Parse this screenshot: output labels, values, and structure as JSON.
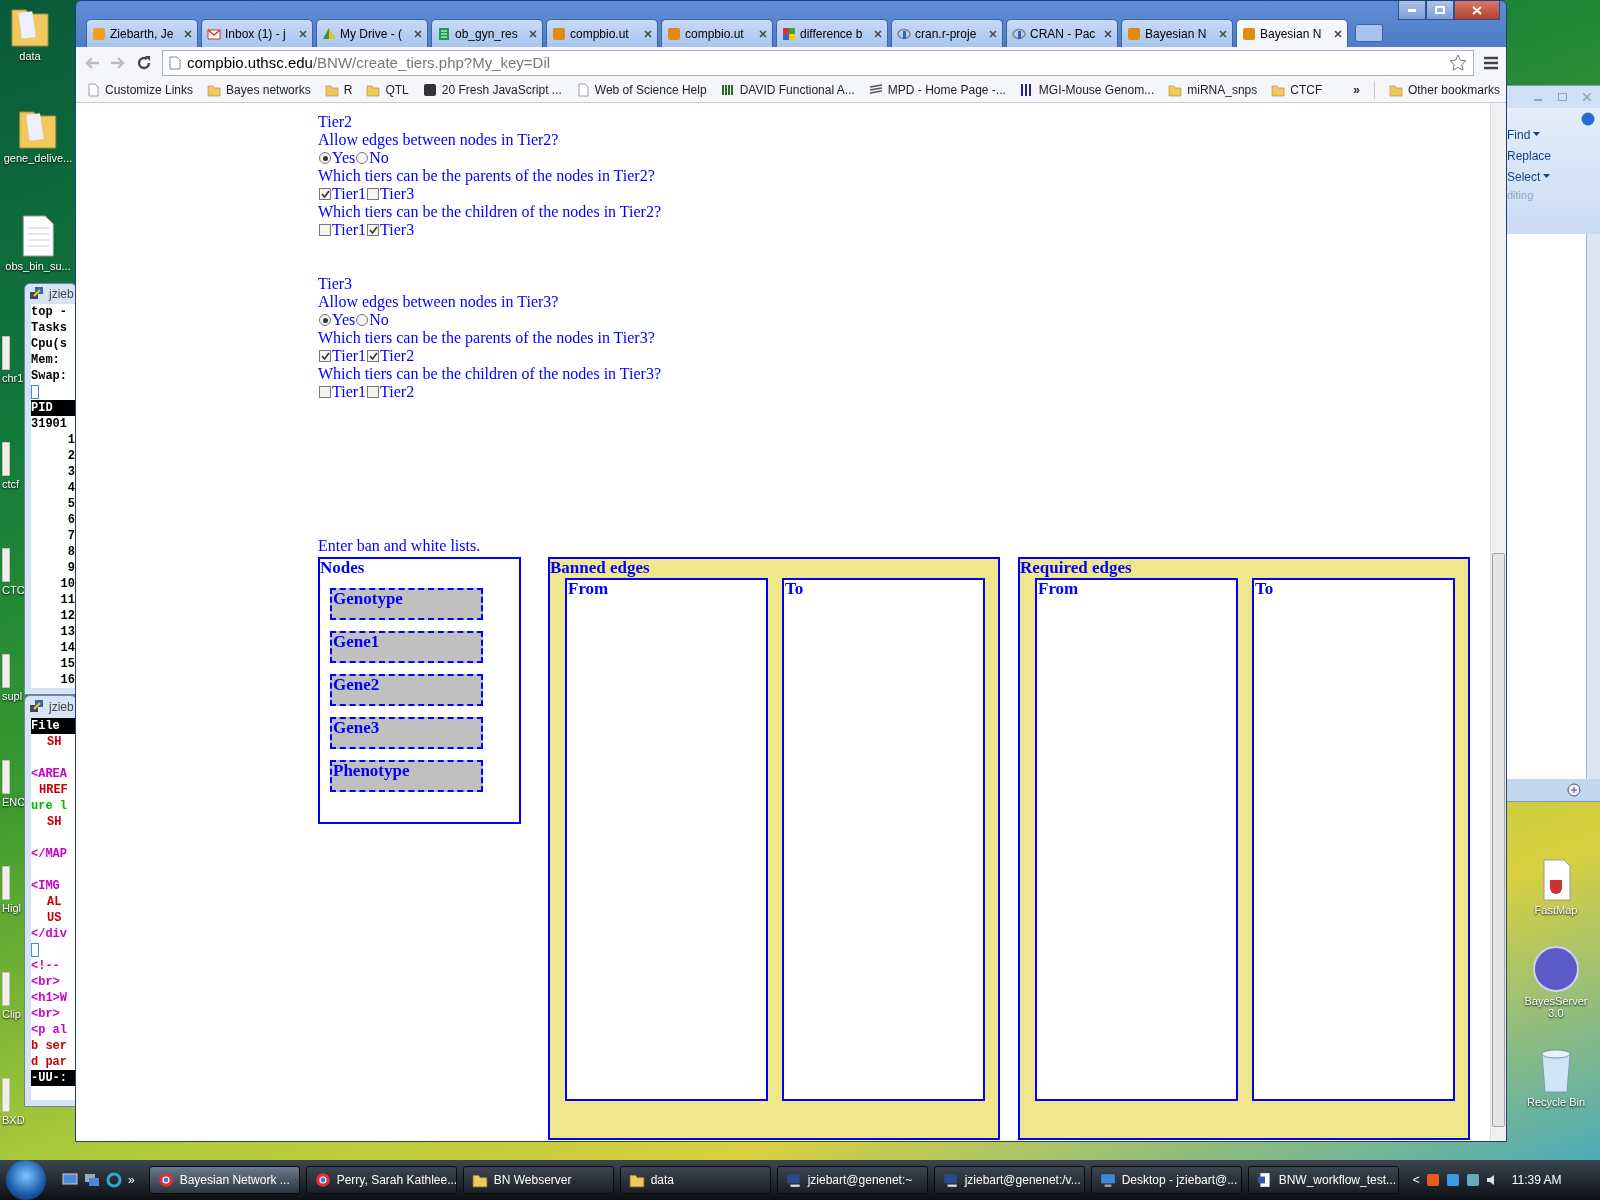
{
  "desktop_icons_left": [
    {
      "label": "data",
      "kind": "folder"
    },
    {
      "label": "gene_delive...",
      "kind": "folder"
    },
    {
      "label": "obs_bin_su...",
      "kind": "file"
    },
    {
      "label": "chr1",
      "kind": "partial"
    },
    {
      "label": "ctcf",
      "kind": "partial"
    },
    {
      "label": "CTC",
      "kind": "partial"
    },
    {
      "label": "supl",
      "kind": "partial"
    },
    {
      "label": "ENC",
      "kind": "partial"
    },
    {
      "label": "Higl",
      "kind": "partial"
    },
    {
      "label": "Clip",
      "kind": "partial"
    },
    {
      "label": "BXD",
      "kind": "partial"
    }
  ],
  "terminals": [
    {
      "title": "jzieb",
      "lines": [
        {
          "text": "top -",
          "kind": "text"
        },
        {
          "text": "Tasks",
          "kind": "text"
        },
        {
          "text": "Cpu(s",
          "kind": "text"
        },
        {
          "text": "Mem:",
          "kind": "text"
        },
        {
          "text": "Swap:",
          "kind": "text"
        },
        {
          "kind": "cursor"
        },
        {
          "text": "PID",
          "kind": "bar"
        },
        {
          "text": "31901",
          "kind": "text"
        },
        {
          "text": "1",
          "kind": "right"
        },
        {
          "text": "2",
          "kind": "right"
        },
        {
          "text": "3",
          "kind": "right"
        },
        {
          "text": "4",
          "kind": "right"
        },
        {
          "text": "5",
          "kind": "right"
        },
        {
          "text": "6",
          "kind": "right"
        },
        {
          "text": "7",
          "kind": "right"
        },
        {
          "text": "8",
          "kind": "right"
        },
        {
          "text": "9",
          "kind": "right"
        },
        {
          "text": "10",
          "kind": "right"
        },
        {
          "text": "11",
          "kind": "right"
        },
        {
          "text": "12",
          "kind": "right"
        },
        {
          "text": "13",
          "kind": "right"
        },
        {
          "text": "14",
          "kind": "right"
        },
        {
          "text": "15",
          "kind": "right"
        },
        {
          "text": "16",
          "kind": "right"
        }
      ]
    },
    {
      "title": "jzieb",
      "lines": [
        {
          "text": "File",
          "kind": "bar"
        },
        {
          "text": "SH",
          "kind": "indented",
          "color": "#cc0000"
        },
        {
          "kind": "blank"
        },
        {
          "text": "<AREA",
          "kind": "text",
          "color": "#cc00cc"
        },
        {
          "text": "HREF",
          "kind": "half",
          "color": "#cc0000"
        },
        {
          "text": "ure l",
          "kind": "text",
          "color": "#00bb00"
        },
        {
          "text": "SH",
          "kind": "indented",
          "color": "#cc0000"
        },
        {
          "kind": "blank"
        },
        {
          "text": "</MAP",
          "kind": "text",
          "color": "#cc00cc"
        },
        {
          "kind": "blank"
        },
        {
          "text": "<IMG",
          "kind": "text",
          "color": "#cc00cc"
        },
        {
          "text": "AL",
          "kind": "indented",
          "color": "#cc0000"
        },
        {
          "text": "US",
          "kind": "indented",
          "color": "#cc0000"
        },
        {
          "text": "</div",
          "kind": "text",
          "color": "#cc00cc"
        },
        {
          "kind": "cursor"
        },
        {
          "text": "<!--",
          "kind": "text",
          "color": "#cc00cc"
        },
        {
          "text": "<br>",
          "kind": "text",
          "color": "#cc00cc"
        },
        {
          "text": "<h1>W",
          "kind": "text",
          "color": "#cc00cc"
        },
        {
          "text": "<br>",
          "kind": "text",
          "color": "#cc00cc"
        },
        {
          "text": "<p al",
          "kind": "text",
          "color": "#cc00cc"
        },
        {
          "text": "b ser",
          "kind": "text",
          "color": "#cc0000"
        },
        {
          "text": "d par",
          "kind": "text",
          "color": "#cc0000"
        },
        {
          "text": "-UU-:",
          "kind": "bar"
        }
      ]
    }
  ],
  "word_window": {
    "ribbon_items": [
      {
        "label": "Find",
        "dropdown": true
      },
      {
        "label": "Replace",
        "dropdown": false
      },
      {
        "label": "Select",
        "dropdown": true
      }
    ],
    "group_label": "diting"
  },
  "desktop_icons_right": [
    {
      "label": "FastMap",
      "kind": "java"
    },
    {
      "label": "BayesServer 3.0",
      "kind": "orb"
    },
    {
      "label": "Recycle Bin",
      "kind": "bin"
    }
  ],
  "browser": {
    "tabs": [
      {
        "label": "Ziebarth, Je",
        "kind": "outlook",
        "selected": false
      },
      {
        "label": "Inbox (1) - j",
        "kind": "mail",
        "selected": false
      },
      {
        "label": "My Drive - (",
        "kind": "drive",
        "selected": false
      },
      {
        "label": "ob_gyn_res",
        "kind": "sheet",
        "selected": false
      },
      {
        "label": "compbio.ut",
        "kind": "ut",
        "selected": false
      },
      {
        "label": "compbio.ut",
        "kind": "ut",
        "selected": false
      },
      {
        "label": "difference b",
        "kind": "google",
        "selected": false
      },
      {
        "label": "cran.r-proje",
        "kind": "r",
        "selected": false
      },
      {
        "label": "CRAN - Pac",
        "kind": "r",
        "selected": false
      },
      {
        "label": "Bayesian N",
        "kind": "ut",
        "selected": false
      },
      {
        "label": "Bayesian N",
        "kind": "ut",
        "selected": true
      }
    ],
    "address": {
      "host": "compbio.uthsc.edu",
      "path": "/BNW/create_tiers.php?My_key=Dil"
    },
    "bookmarks": [
      {
        "label": "Customize Links",
        "kind": "page"
      },
      {
        "label": "Bayes networks",
        "kind": "folder"
      },
      {
        "label": "R",
        "kind": "folder"
      },
      {
        "label": "QTL",
        "kind": "folder"
      },
      {
        "label": "20 Fresh JavaScript ...",
        "kind": "dark"
      },
      {
        "label": "Web of Science Help",
        "kind": "page"
      },
      {
        "label": "DAVID Functional A...",
        "kind": "david"
      },
      {
        "label": "MPD - Home Page -...",
        "kind": "stripes"
      },
      {
        "label": "MGI-Mouse Genom...",
        "kind": "mgi"
      },
      {
        "label": "miRNA_snps",
        "kind": "folder"
      },
      {
        "label": "CTCF",
        "kind": "folder"
      }
    ],
    "bookmarks_overflow": "»",
    "other_bookmarks": "Other bookmarks",
    "tiers": [
      {
        "title": "Tier2",
        "allow_question": "Allow edges between nodes in Tier2?",
        "allow_options": [
          {
            "label": "Yes",
            "selected": true
          },
          {
            "label": "No",
            "selected": false
          }
        ],
        "parents_question": "Which tiers can be the parents of the nodes in Tier2?",
        "parents": [
          {
            "label": "Tier1",
            "checked": true
          },
          {
            "label": "Tier3",
            "checked": false
          }
        ],
        "children_question": "Which tiers can be the children of the nodes in Tier2?",
        "children": [
          {
            "label": "Tier1",
            "checked": false
          },
          {
            "label": "Tier3",
            "checked": true
          }
        ]
      },
      {
        "title": "Tier3",
        "allow_question": "Allow edges between nodes in Tier3?",
        "allow_options": [
          {
            "label": "Yes",
            "selected": true
          },
          {
            "label": "No",
            "selected": false
          }
        ],
        "parents_question": "Which tiers can be the parents of the nodes in Tier3?",
        "parents": [
          {
            "label": "Tier1",
            "checked": true
          },
          {
            "label": "Tier2",
            "checked": true
          }
        ],
        "children_question": "Which tiers can be the children of the nodes in Tier3?",
        "children": [
          {
            "label": "Tier1",
            "checked": false
          },
          {
            "label": "Tier2",
            "checked": false
          }
        ]
      }
    ],
    "lists_heading": "Enter ban and white lists.",
    "nodes_panel": {
      "title": "Nodes",
      "nodes": [
        "Genotype",
        "Gene1",
        "Gene2",
        "Gene3",
        "Phenotype"
      ]
    },
    "edge_panels": [
      {
        "title": "Banned edges",
        "columns": [
          "From",
          "To"
        ]
      },
      {
        "title": "Required edges",
        "columns": [
          "From",
          "To"
        ]
      }
    ]
  },
  "taskbar": {
    "tasks": [
      {
        "label": "Bayesian Network ...",
        "kind": "chrome",
        "selected": true
      },
      {
        "label": "Perry, Sarah Kathlee...",
        "kind": "chrome",
        "selected": false
      },
      {
        "label": "BN Webserver",
        "kind": "folder",
        "selected": false
      },
      {
        "label": "data",
        "kind": "folder",
        "selected": false
      },
      {
        "label": "jziebart@genenet:~",
        "kind": "terminal",
        "selected": false
      },
      {
        "label": "jziebart@genenet:/v...",
        "kind": "terminal",
        "selected": false
      },
      {
        "label": "Desktop - jziebart@...",
        "kind": "desktop",
        "selected": false
      },
      {
        "label": "BNW_workflow_test...",
        "kind": "doc",
        "selected": false
      }
    ],
    "quick_launch_more": "»",
    "tray_expand": "<",
    "clock": "11:39 AM"
  }
}
